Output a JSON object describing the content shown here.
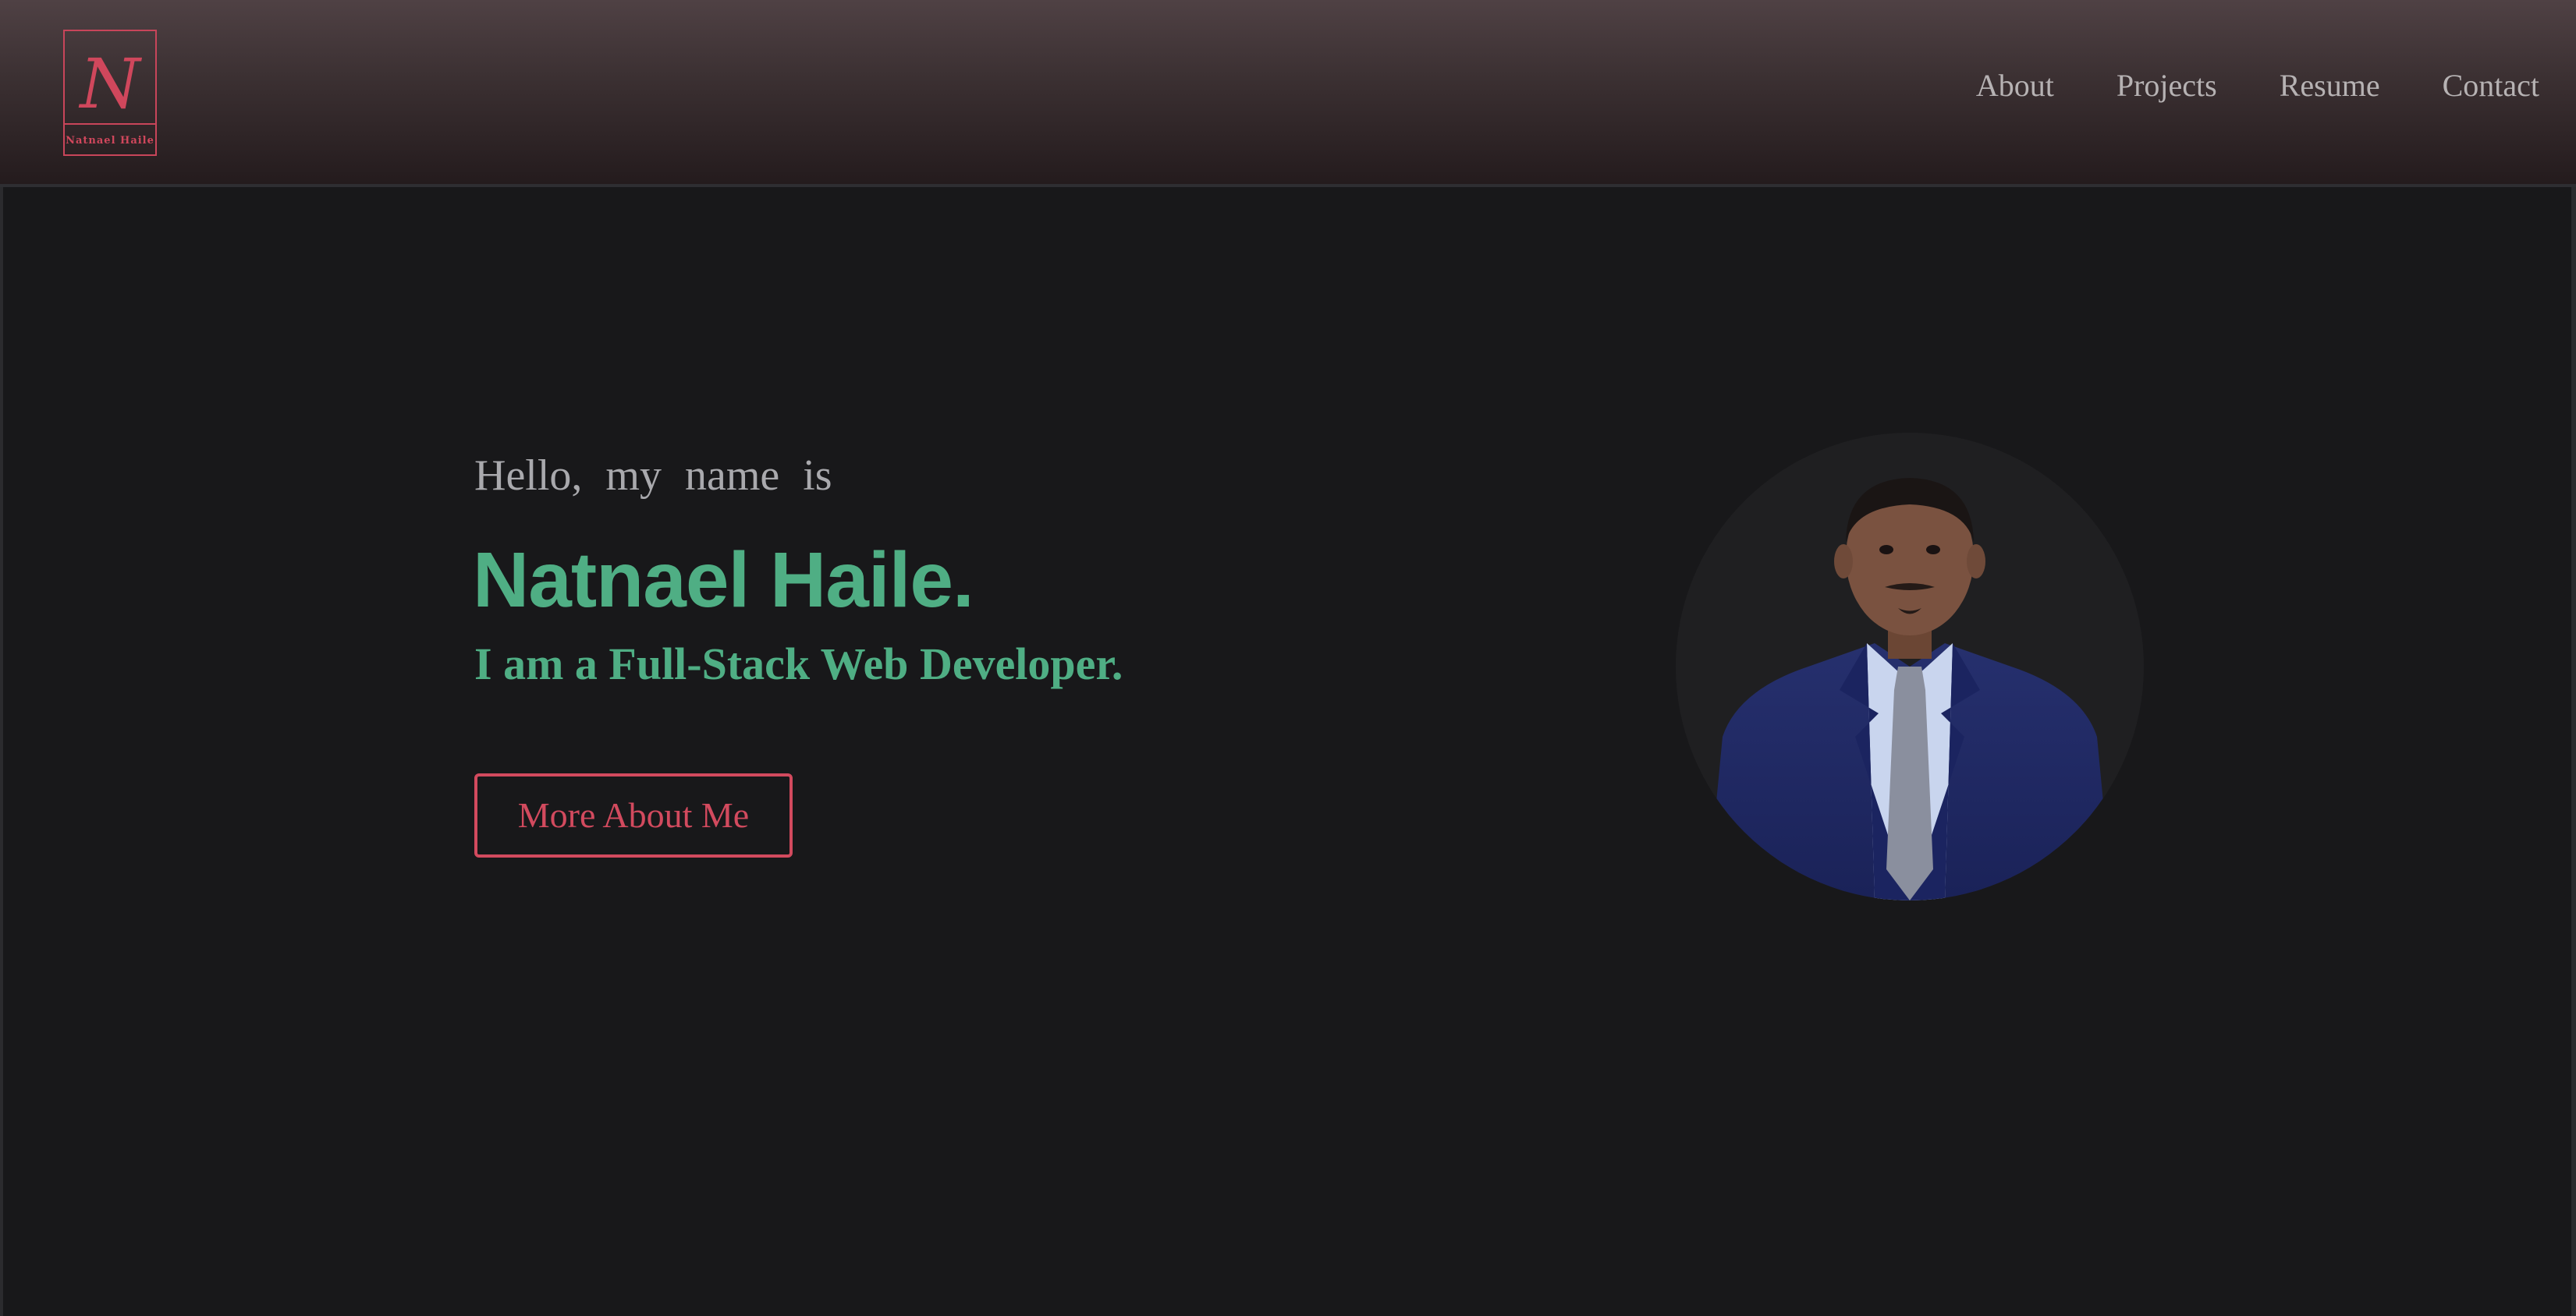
{
  "logo": {
    "letter": "N",
    "name": "Natnael Haile"
  },
  "nav": [
    {
      "label": "About"
    },
    {
      "label": "Projects"
    },
    {
      "label": "Resume"
    },
    {
      "label": "Contact"
    }
  ],
  "hero": {
    "greeting": "Hello, my name is",
    "name": "Natnael Haile.",
    "tagline": "I am a Full-Stack Web Developer.",
    "cta_label": "More About Me"
  },
  "colors": {
    "accent_green": "#4fae84",
    "accent_red": "#d24a5e",
    "background": "#18181a"
  }
}
